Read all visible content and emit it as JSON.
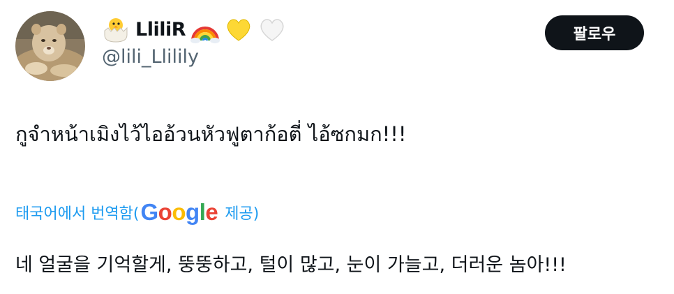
{
  "user": {
    "display_name": "LliliR",
    "handle": "@lili_Llilily",
    "name_emojis": [
      "hatching-chick-icon",
      "rainbow-icon",
      "yellow-heart-icon",
      "white-heart-icon"
    ]
  },
  "follow_button": {
    "label": "팔로우"
  },
  "tweet": {
    "text": "กูจำหน้าเมิงไว้ไออ้วนหัวฟูตาก้อตี่ ไอ้ซกมก!!!"
  },
  "translation": {
    "prefix": "태국어에서 번역함(",
    "provider": "Google",
    "suffix": " 제공)",
    "text": "네 얼굴을 기억할게, 뚱뚱하고, 털이 많고, 눈이 가늘고, 더러운 놈아!!!"
  },
  "colors": {
    "link_blue": "#1d9bf0",
    "secondary_text": "#536471",
    "primary_text": "#0f1419",
    "button_bg": "#0f1419"
  }
}
